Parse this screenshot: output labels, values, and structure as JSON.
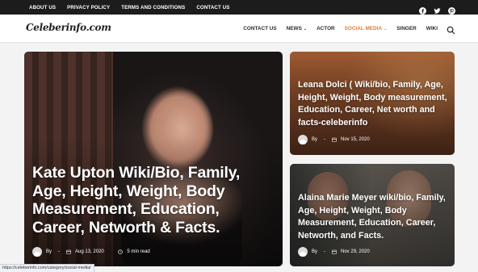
{
  "topbar": {
    "links": [
      "ABOUT US",
      "PRIVACY POLICY",
      "TERMS AND CONDITIONS",
      "CONTACT US"
    ],
    "social_icons": [
      "facebook-icon",
      "twitter-icon",
      "pinterest-icon"
    ]
  },
  "header": {
    "logo": "Celeberinfo.com",
    "nav": [
      {
        "label": "CONTACT US"
      },
      {
        "label": "NEWS",
        "has_dropdown": true
      },
      {
        "label": "ACTOR"
      },
      {
        "label": "SOCIAL MEDIA",
        "has_dropdown": true,
        "active": true
      },
      {
        "label": "SINGER"
      },
      {
        "label": "WIKI"
      }
    ],
    "search_icon": "search-icon"
  },
  "posts": {
    "main": {
      "title": "Kate Upton Wiki/Bio, Family, Age, Height, Weight, Body Measurement, Education, Career, Networth & Facts.",
      "author_prefix": "By",
      "separator": "-",
      "date": "Aug 13, 2020",
      "read_time": "5 min read"
    },
    "side1": {
      "title": "Leana Dolci ( Wiki/bio, Family, Age, Height, Weight, Body measurement, Education, Career, Net worth and facts-celeberinfo",
      "author_prefix": "By",
      "separator": "-",
      "date": "Nov 15, 2020"
    },
    "side2": {
      "title": "Alaina Marie Meyer wiki/bio, Family, Age, Height, Weight, Body Measurement, Education, Career, Networth, and Facts.",
      "author_prefix": "By",
      "separator": "-",
      "date": "Nov 29, 2020"
    }
  },
  "status_url": "https://celeberinfo.com/category/social-media/",
  "colors": {
    "topbar_bg": "#1c1c1c",
    "accent": "#e57a3b",
    "page_bg": "#f3f3f3"
  }
}
